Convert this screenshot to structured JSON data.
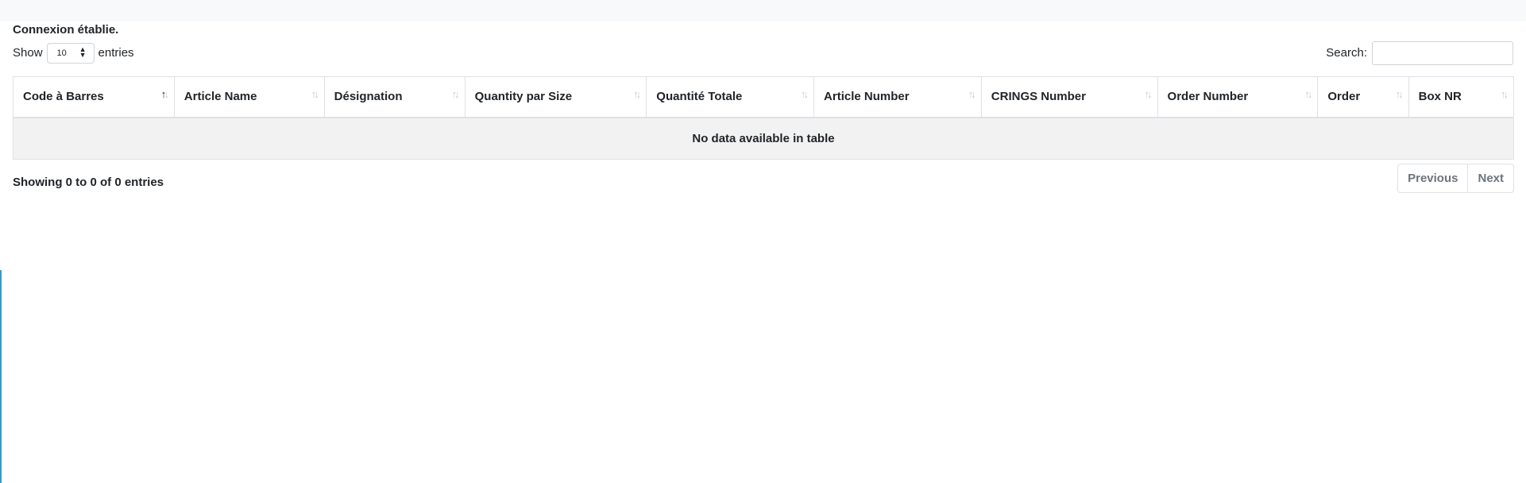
{
  "status_message": "Connexion établie.",
  "length_control": {
    "prefix": "Show",
    "selected_value": "10",
    "suffix": "entries"
  },
  "search": {
    "label": "Search:",
    "value": "",
    "placeholder": ""
  },
  "table": {
    "columns": [
      {
        "label": "Code à Barres"
      },
      {
        "label": "Article Name"
      },
      {
        "label": "Désignation"
      },
      {
        "label": "Quantity par Size"
      },
      {
        "label": "Quantité Totale"
      },
      {
        "label": "Article Number"
      },
      {
        "label": "CRINGS Number"
      },
      {
        "label": "Order Number"
      },
      {
        "label": "Order"
      },
      {
        "label": "Box NR"
      }
    ],
    "empty_message": "No data available in table"
  },
  "info_text": "Showing 0 to 0 of 0 entries",
  "pagination": {
    "previous_label": "Previous",
    "next_label": "Next"
  },
  "icons": {
    "sort": "sort-arrows-icon",
    "select_caret": "select-caret-icon"
  }
}
